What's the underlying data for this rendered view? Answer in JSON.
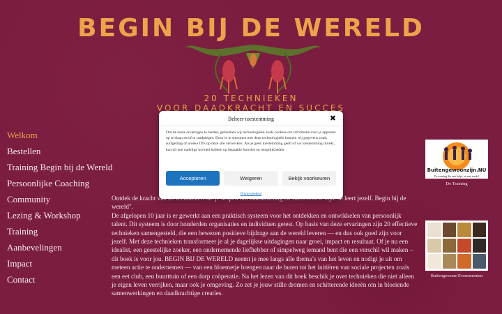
{
  "site": {
    "title": "BEGIN BIJ DE WERELD",
    "tagline_line1": "20 TECHNIEKEN",
    "tagline_line2": "VOOR DAADKRACHT EN SUCCES"
  },
  "colors": {
    "background": "#7b1d40",
    "accent": "#eda34a",
    "active_nav": "#ef9b4e",
    "primary_button": "#1e73be"
  },
  "nav": {
    "items": [
      {
        "label": "Welkom",
        "active": true
      },
      {
        "label": "Bestellen"
      },
      {
        "label": "Training Begin bij de Wereld"
      },
      {
        "label": "Persoonlijke Coaching"
      },
      {
        "label": "Community"
      },
      {
        "label": "Lezing & Workshop"
      },
      {
        "label": "Training"
      },
      {
        "label": "Aanbevelingen"
      },
      {
        "label": "Impact"
      },
      {
        "label": "Contact"
      }
    ]
  },
  "main": {
    "p1": "Ontdek de kracht van 20 technieken die je helpen om daadkrachtig en succesvol te zijn. Je leert jezelf. Begin bij de wereld\".",
    "p2": "De afgelopen 10 jaar is er gewerkt aan een praktisch systeem voor het ontdekken en ontwikkelen van persoonlijk talent. Dit systeem is door honderden organisaties en individuen getest. Op basis van deze ervaringen zijn 20 effectieve technieken samengesteld, die een bewezen positieve bijdrage aan de wereld leveren — en dus ook goed zijn voor jezelf. Met deze technieken transformeer je al je dagelijkse uitdagingen naar groei, impact en resultaat. Of je nu een idealist, een geestelijke zoeker, een ondernemende liefhebber of simpelweg iemand bent die een verschil wil maken – dit boek is voor jou. BEGIN BIJ DE WERELD neemt je mee langs alle thema’s van het leven en nodigt je uit om meteen actie te ondernemen — van een bloemetje brengen naar de buren tot het initiëren van sociale projecten zoals een eet club, een buurttuin of een dorp coöperatie. Na het lezen van dit boek beschik je over technieken die niet alleen je eigen leven verrijken, maar ook je omgeving. Zo zet je jouw stille dromen en schitterende ideeën om in bloeiende samenwerkingen en daadkrachtige creaties."
  },
  "sidebar": {
    "ad1_label": "Buitengewoonzijn.NU",
    "ad1_sub": "De training die met helpt, en niet werkt!",
    "ad1_caption": "De Training",
    "ad2_caption": "Buitengewone Evenementen"
  },
  "cookie_modal": {
    "title": "Beheer toestemming",
    "close": "✖",
    "body": "Om de beste ervaringen te bieden, gebruiken wij technologieën zoals cookies om informatie over je apparaat op te slaan en/of te raadplegen. Door in te stemmen met deze technologieën kunnen wij gegevens zoals surfgedrag of unieke ID's op deze site verwerken. Als je geen toestemming geeft of uw toestemming intrekt, kan dit een nadelige invloed hebben op bepaalde functies en mogelijkheden.",
    "accept": "Accepteren",
    "deny": "Weigeren",
    "preferences": "Bekijk voorkeuren",
    "privacy_link": "Privacybeleid"
  }
}
